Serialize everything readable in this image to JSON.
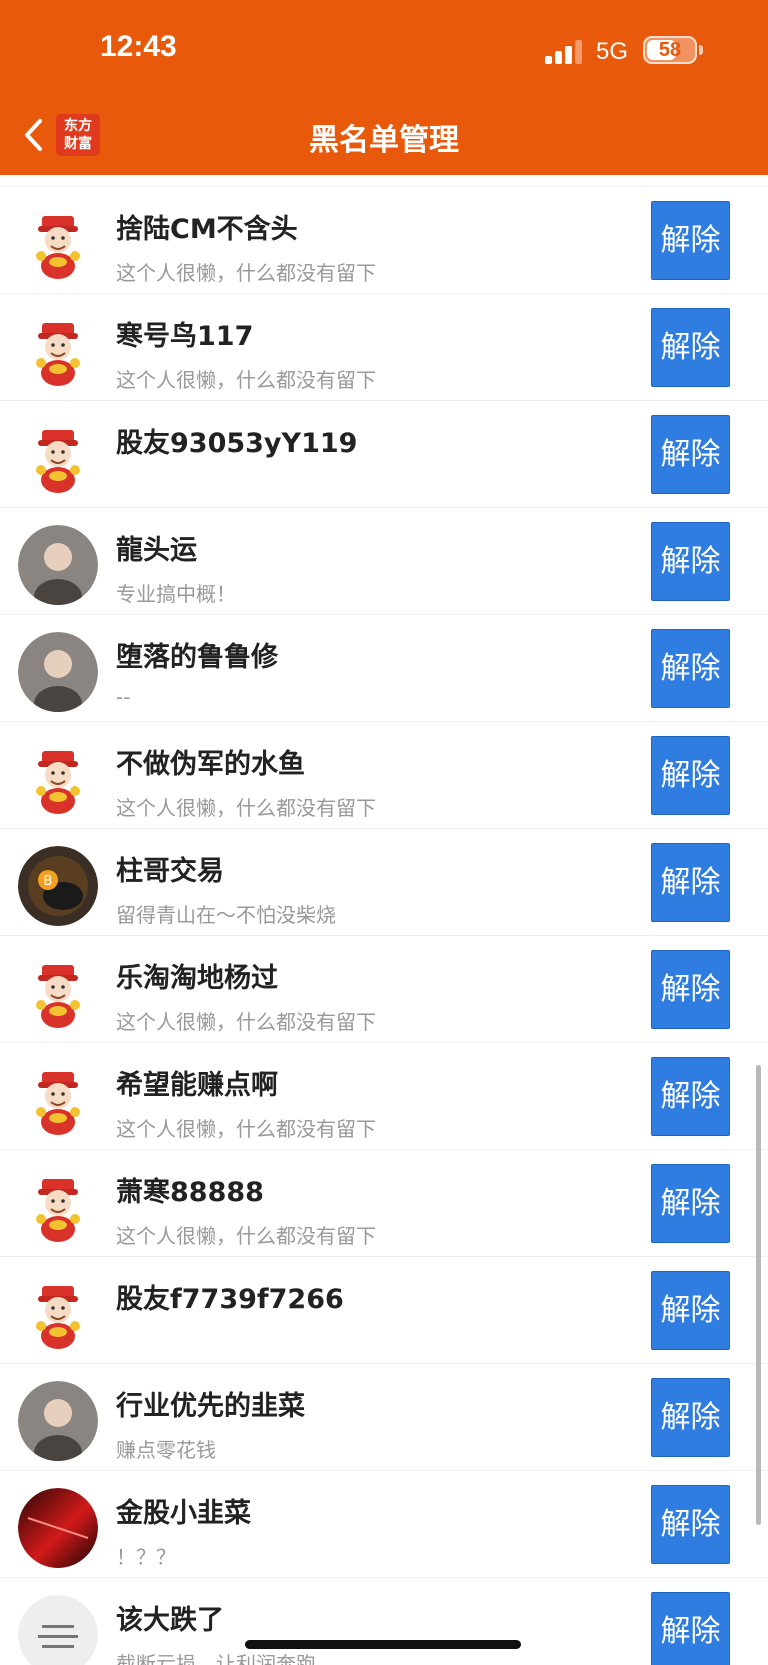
{
  "status": {
    "time": "12:43",
    "network": "5G",
    "battery": "58",
    "battery_level": 0.58
  },
  "navbar": {
    "title": "黑名单管理",
    "logo_line1": "东方",
    "logo_line2": "财富",
    "back_icon": "chevron-left-icon"
  },
  "colors": {
    "header": "#e8590c",
    "button": "#2f7de1"
  },
  "blacklist": {
    "unblock_label": "解除",
    "items": [
      {
        "name": "捨陆CM不含头",
        "bio": "这个人很懒，什么都没有留下",
        "avatar": "mascot-avatar"
      },
      {
        "name": "寒号鸟117",
        "bio": "这个人很懒，什么都没有留下",
        "avatar": "mascot-avatar"
      },
      {
        "name": "股友93053yY119",
        "bio": "",
        "avatar": "mascot-avatar"
      },
      {
        "name": "龍头运",
        "bio": "专业搞中概！",
        "avatar": "photo-avatar"
      },
      {
        "name": "堕落的鲁鲁修",
        "bio": "--",
        "avatar": "photo-avatar"
      },
      {
        "name": "不做伪军的水鱼",
        "bio": "这个人很懒，什么都没有留下",
        "avatar": "mascot-avatar"
      },
      {
        "name": "柱哥交易",
        "bio": "留得青山在～不怕没柴烧",
        "avatar": "bull-avatar"
      },
      {
        "name": "乐淘淘地杨过",
        "bio": "这个人很懒，什么都没有留下",
        "avatar": "mascot-avatar"
      },
      {
        "name": "希望能赚点啊",
        "bio": "这个人很懒，什么都没有留下",
        "avatar": "mascot-avatar"
      },
      {
        "name": "萧寒88888",
        "bio": "这个人很懒，什么都没有留下",
        "avatar": "mascot-avatar"
      },
      {
        "name": "股友f7739f7266",
        "bio": "",
        "avatar": "mascot-avatar"
      },
      {
        "name": "行业优先的韭菜",
        "bio": "赚点零花钱",
        "avatar": "photo-avatar"
      },
      {
        "name": "金股小韭菜",
        "bio": "！？？",
        "avatar": "abstract-avatar"
      },
      {
        "name": "该大跌了",
        "bio": "截断亏损，让利润奔跑",
        "avatar": "text-avatar"
      }
    ]
  }
}
